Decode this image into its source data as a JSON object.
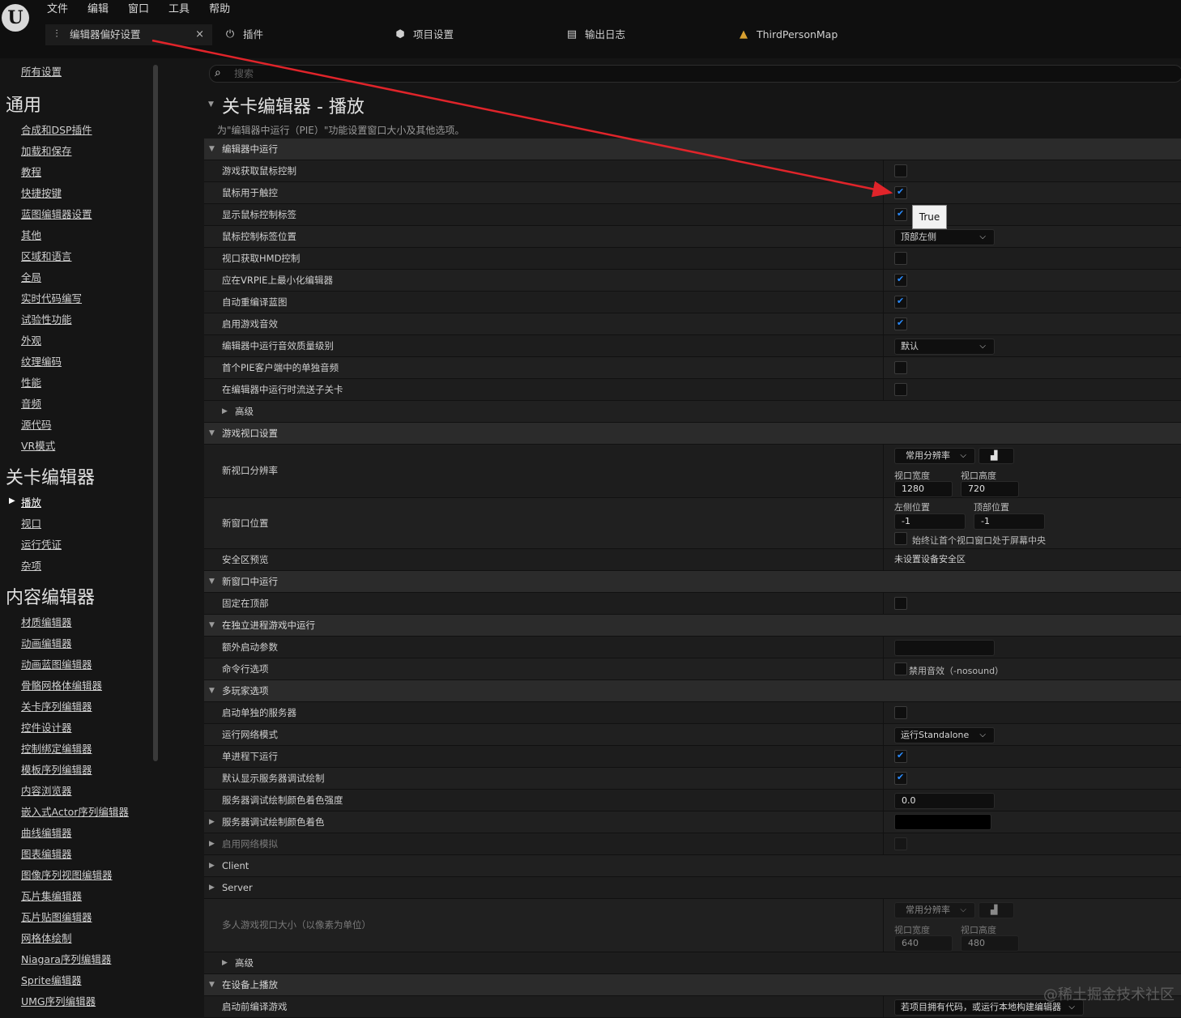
{
  "menubar": [
    "文件",
    "编辑",
    "窗口",
    "工具",
    "帮助"
  ],
  "tabs": [
    {
      "label": "编辑器偏好设置",
      "icon": "sliders-icon",
      "close": "×"
    },
    {
      "label": "插件",
      "icon": "plug-icon"
    },
    {
      "label": "项目设置",
      "icon": "box-icon"
    },
    {
      "label": "输出日志",
      "icon": "log-icon"
    },
    {
      "label": "ThirdPersonMap",
      "icon": "level-icon"
    }
  ],
  "sidebar": {
    "all": "所有设置",
    "sections": [
      {
        "title": "通用",
        "items": [
          "合成和DSP插件",
          "加载和保存",
          "教程",
          "快捷按键",
          "蓝图编辑器设置",
          "其他",
          "区域和语言",
          "全局",
          "实时代码编写",
          "试验性功能",
          "外观",
          "纹理编码",
          "性能",
          "音频",
          "源代码",
          "VR模式"
        ]
      },
      {
        "title": "关卡编辑器",
        "items": [
          "播放",
          "视口",
          "运行凭证",
          "杂项"
        ]
      },
      {
        "title": "内容编辑器",
        "items": [
          "材质编辑器",
          "动画编辑器",
          "动画蓝图编辑器",
          "骨骼网格体编辑器",
          "关卡序列编辑器",
          "控件设计器",
          "控制绑定编辑器",
          "模板序列编辑器",
          "内容浏览器",
          "嵌入式Actor序列编辑器",
          "曲线编辑器",
          "图表编辑器",
          "图像序列视图编辑器",
          "瓦片集编辑器",
          "瓦片贴图编辑器",
          "网格体绘制",
          "Niagara序列编辑器",
          "Sprite编辑器",
          "UMG序列编辑器"
        ]
      }
    ],
    "selected": "播放"
  },
  "search": {
    "placeholder": "搜索"
  },
  "page": {
    "title": "关卡编辑器 - 播放",
    "description": "为\"编辑器中运行（PIE）\"功能设置窗口大小及其他选项。"
  },
  "rows": {
    "cat_pie": "编辑器中运行",
    "game_gets_mouse": "游戏获取鼠标控制",
    "mouse_for_touch": "鼠标用于触控",
    "show_mouse_label": "显示鼠标控制标签",
    "mouse_label_pos": "鼠标控制标签位置",
    "mouse_label_pos_value": "顶部左侧",
    "viewport_hmd": "视口获取HMD控制",
    "minimize_vrpie": "应在VRPIE上最小化编辑器",
    "auto_recompile": "自动重编译蓝图",
    "enable_sound": "启用游戏音效",
    "audio_quality": "编辑器中运行音效质量级别",
    "audio_quality_value": "默认",
    "solo_audio": "首个PIE客户端中的单独音频",
    "stream_sublevels": "在编辑器中运行时流送子关卡",
    "advanced": "高级",
    "cat_viewport": "游戏视口设置",
    "new_res": "新视口分辨率",
    "common_res": "常用分辨率",
    "vp_width_label": "视口宽度",
    "vp_height_label": "视口高度",
    "vp_width": "1280",
    "vp_height": "720",
    "new_pos": "新窗口位置",
    "left_pos_label": "左侧位置",
    "top_pos_label": "顶部位置",
    "left_pos": "-1",
    "top_pos": "-1",
    "center_first": "始终让首个视口窗口处于屏幕中央",
    "safe_zone": "安全区预览",
    "safe_zone_value": "未设置设备安全区",
    "cat_new_window": "新窗口中运行",
    "always_on_top": "固定在顶部",
    "cat_standalone": "在独立进程游戏中运行",
    "extra_args": "额外启动参数",
    "cmd_options": "命令行选项",
    "nosound": "禁用音效（-nosound）",
    "cat_multiplayer": "多玩家选项",
    "separate_server": "启动单独的服务器",
    "net_mode": "运行网络模式",
    "net_mode_value": "运行Standalone",
    "single_process": "单进程下运行",
    "server_debug_draw": "默认显示服务器调试绘制",
    "server_tint_strength": "服务器调试绘制颜色着色强度",
    "server_tint_strength_value": "0.0",
    "server_tint": "服务器调试绘制颜色着色",
    "net_emulation": "启用网络模拟",
    "client": "Client",
    "server": "Server",
    "mp_viewport": "多人游戏视口大小（以像素为单位）",
    "mp_width": "640",
    "mp_height": "480",
    "cat_device": "在设备上播放",
    "build_game": "启动前编译游戏",
    "build_game_value": "若项目拥有代码，或运行本地构建编辑器"
  },
  "tooltip": "True",
  "colors": {
    "arrow": "#e0242a",
    "checkbox_on": "#2a8cff"
  },
  "watermark": "@稀土掘金技术社区"
}
